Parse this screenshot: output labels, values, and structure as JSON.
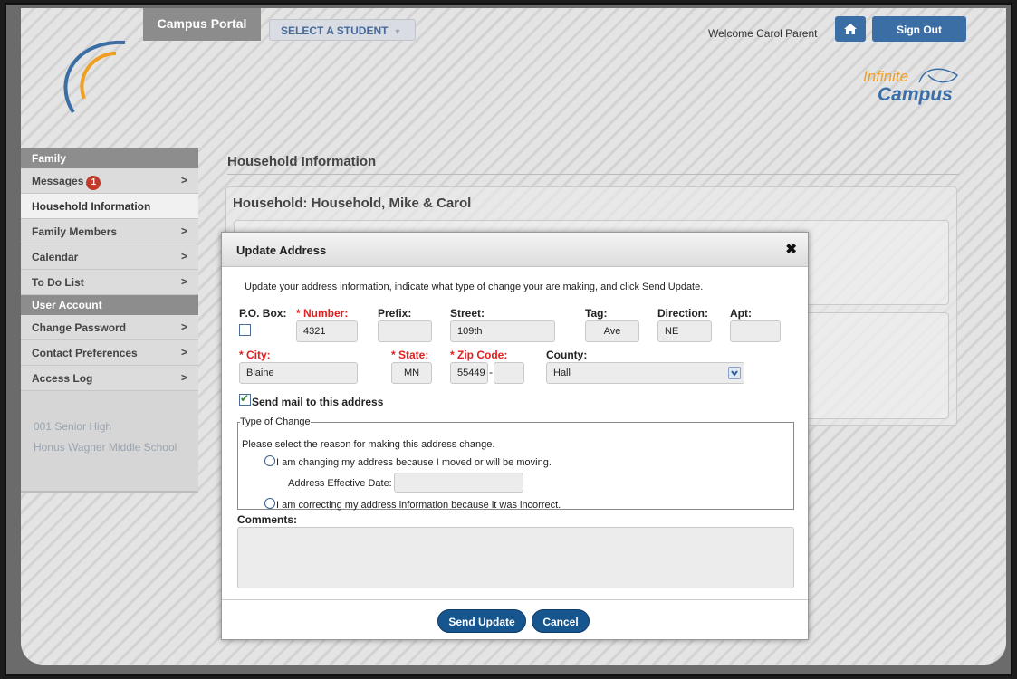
{
  "header": {
    "portal_tab": "Campus Portal",
    "select_student": "SELECT A STUDENT",
    "welcome": "Welcome Carol Parent",
    "sign_out": "Sign Out",
    "logo_line1": "Infinite",
    "logo_line2": "Campus"
  },
  "sidebar": {
    "family_head": "Family",
    "messages": {
      "label": "Messages",
      "badge": "1"
    },
    "household_info": "Household Information",
    "family_members": "Family Members",
    "calendar": "Calendar",
    "todo": "To Do List",
    "account_head": "User Account",
    "change_password": "Change Password",
    "contact_prefs": "Contact Preferences",
    "access_log": "Access Log",
    "arrow": ">",
    "schools": [
      "001 Senior High",
      "Honus Wagner Middle School"
    ]
  },
  "content": {
    "title": "Household Information",
    "household": "Household: Household, Mike & Carol"
  },
  "modal": {
    "title": "Update Address",
    "close": "✖",
    "instructions": "Update your address information, indicate what type of change your are making, and click Send Update.",
    "labels": {
      "po_box": "P.O. Box:",
      "number": "* Number:",
      "prefix": "Prefix:",
      "street": "Street:",
      "tag": "Tag:",
      "direction": "Direction:",
      "apt": "Apt:",
      "city": "* City:",
      "state": "* State:",
      "zip": "* Zip Code:",
      "county": "County:",
      "dash": "-"
    },
    "values": {
      "number": "4321",
      "prefix": "",
      "street": "109th",
      "tag": "Ave",
      "direction": "NE",
      "apt": "",
      "city": "Blaine",
      "state": "MN",
      "zip": "55449",
      "zip_ext": "",
      "county": "Hall"
    },
    "send_mail_label": "Send mail to this address",
    "type_of_change": {
      "legend": "Type of Change",
      "prompt": "Please select the reason for making this address change.",
      "option_moving": "I am changing my address because I moved or will be moving.",
      "effective_date_label": "Address Effective Date:",
      "effective_date_value": "",
      "option_correcting": "I am correcting my address information because it was incorrect."
    },
    "comments_label": "Comments:",
    "comments_value": "",
    "send_button": "Send Update",
    "cancel_button": "Cancel"
  }
}
